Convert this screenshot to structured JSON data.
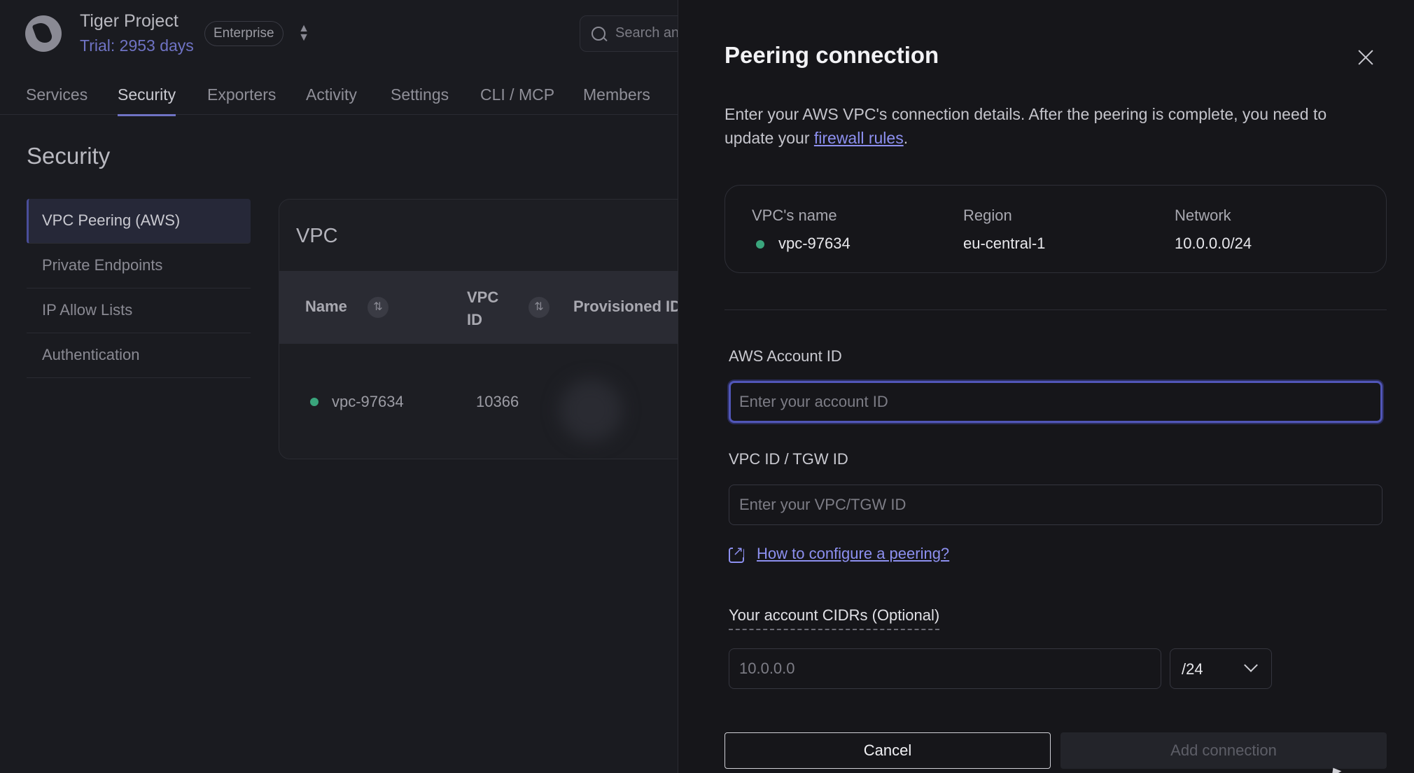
{
  "project": {
    "name": "Tiger Project",
    "trial": "Trial: 2953 days",
    "plan": "Enterprise"
  },
  "search": {
    "placeholder": "Search an"
  },
  "nav": {
    "tabs": [
      {
        "label": "Services"
      },
      {
        "label": "Security",
        "active": true
      },
      {
        "label": "Exporters"
      },
      {
        "label": "Activity"
      },
      {
        "label": "Settings"
      },
      {
        "label": "CLI / MCP"
      },
      {
        "label": "Members"
      }
    ]
  },
  "page": {
    "title": "Security"
  },
  "sidebar": {
    "items": [
      {
        "label": "VPC Peering (AWS)",
        "active": true
      },
      {
        "label": "Private Endpoints"
      },
      {
        "label": "IP Allow Lists"
      },
      {
        "label": "Authentication"
      }
    ]
  },
  "vpc_card": {
    "title": "VPC",
    "columns": [
      "Name",
      "VPC ID",
      "Provisioned ID"
    ],
    "rows": [
      {
        "name": "vpc-97634",
        "vpc_id": "10366",
        "status_color": "#3aa57c"
      }
    ]
  },
  "drawer": {
    "title": "Peering connection",
    "intro_prefix": "Enter your AWS VPC's connection details. After the peering is complete, you need to update your ",
    "intro_link": "firewall rules",
    "intro_suffix": ".",
    "info": {
      "name_label": "VPC's name",
      "name_value": "vpc-97634",
      "region_label": "Region",
      "region_value": "eu-central-1",
      "network_label": "Network",
      "network_value": "10.0.0.0/24"
    },
    "account_field": {
      "label": "AWS Account ID",
      "placeholder": "Enter your account ID",
      "value": ""
    },
    "vpc_field": {
      "label": "VPC ID / TGW ID",
      "placeholder": "Enter your VPC/TGW ID",
      "value": ""
    },
    "help_link": "How to configure a peering?",
    "cidr": {
      "label": "Your account CIDRs (Optional)",
      "placeholder": "10.0.0.0",
      "prefix": "/24"
    },
    "buttons": {
      "cancel": "Cancel",
      "add": "Add connection"
    }
  },
  "colors": {
    "accent": "#6f73c4",
    "link": "#8d90f0",
    "status_green": "#3aa57c",
    "focus_border": "#5156b8"
  },
  "icons": [
    "logo-icon",
    "switch-icon",
    "search-icon",
    "sort-icon",
    "close-icon",
    "external-link-icon",
    "chevron-down-icon"
  ]
}
